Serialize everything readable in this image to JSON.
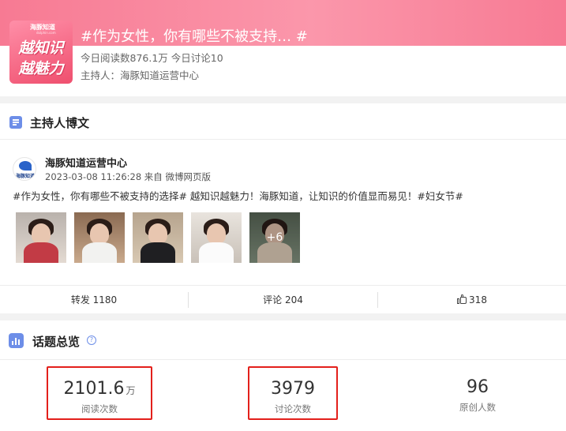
{
  "header": {
    "logo_brand": "海豚知道",
    "logo_brand_sub": "dolphin.com",
    "logo_line1": "越知识",
    "logo_line2": "越魅力",
    "title": "#作为女性，你有哪些不被支持… #",
    "stats": "今日阅读数876.1万 今日讨论10",
    "host": "主持人：海豚知道运营中心"
  },
  "host_post": {
    "section_title": "主持人博文",
    "author_avatar_text": "海豚知道",
    "author_name": "海豚知道运营中心",
    "meta": "2023-03-08 11:26:28 来自 微博网页版",
    "text": "#作为女性，你有哪些不被支持的选择# 越知识越魅力！海豚知道，让知识的价值显而易见！#妇女节#",
    "more_images": "+6",
    "actions": {
      "repost": "转发 1180",
      "comment": "评论 204",
      "like": "318"
    }
  },
  "overview": {
    "title": "话题总览",
    "help_icon": "?",
    "stats": [
      {
        "value": "2101.6",
        "unit": "万",
        "label": "阅读次数",
        "highlighted": true
      },
      {
        "value": "3979",
        "unit": "",
        "label": "讨论次数",
        "highlighted": true
      },
      {
        "value": "96",
        "unit": "",
        "label": "原创人数",
        "highlighted": false
      }
    ]
  },
  "colors": {
    "header_pink": "#f77a93",
    "accent_blue": "#6d8ee8",
    "highlight_red": "#e3201b"
  }
}
